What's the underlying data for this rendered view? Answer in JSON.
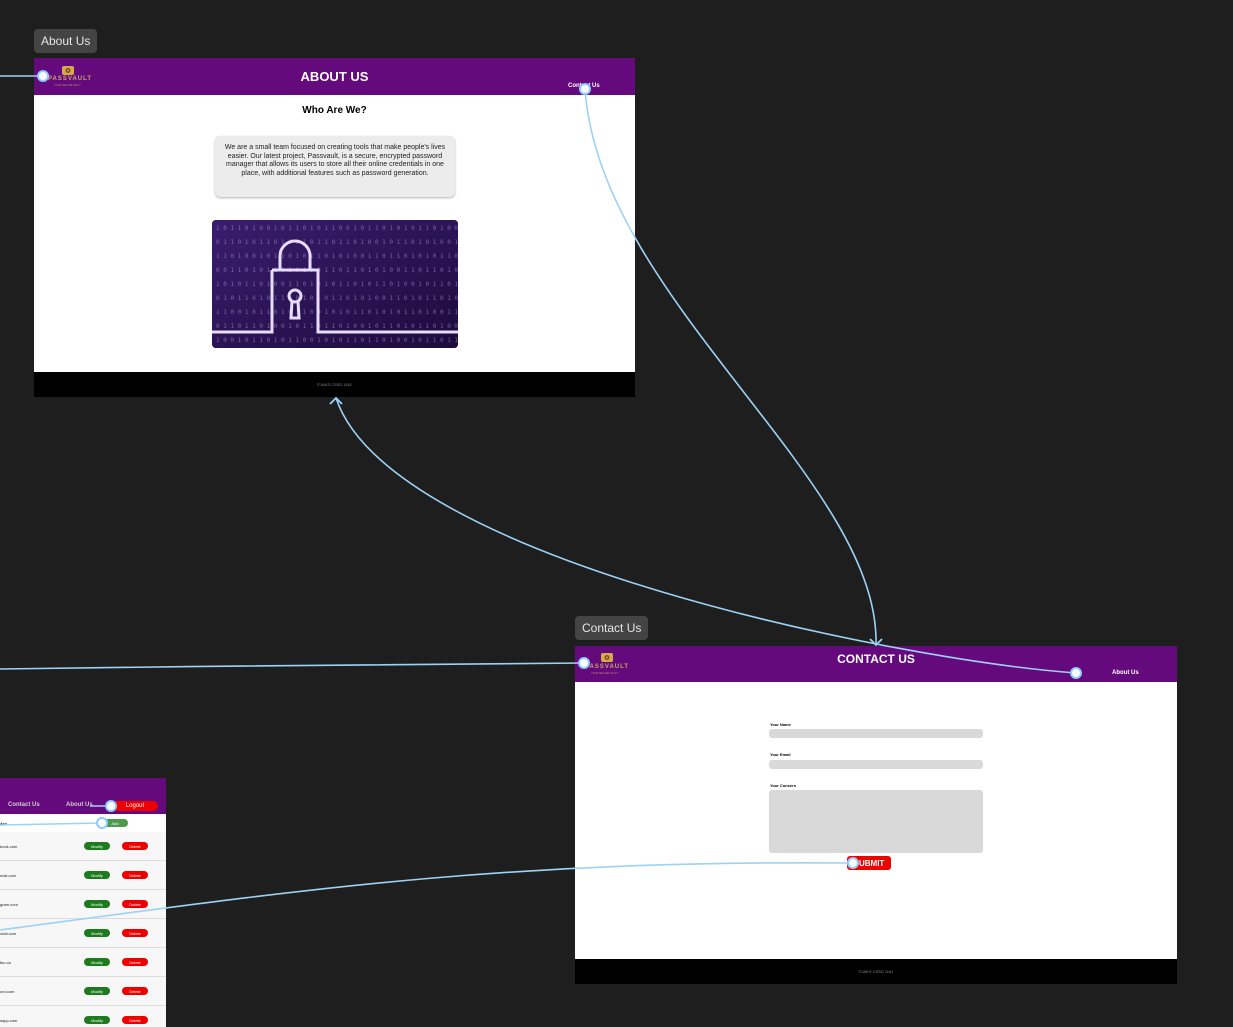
{
  "canvas": {
    "connector_color": "#9dd2f5",
    "frames": [
      {
        "id": "about",
        "label": "About Us"
      },
      {
        "id": "contact",
        "label": "Contact Us"
      }
    ]
  },
  "brand": {
    "primary": "#650a7c",
    "footer": "#000000",
    "danger": "#ee0000",
    "success": "#1d7a1d"
  },
  "about": {
    "logo_word": "PASSVAULT",
    "logo_sub": "YOUR SECURE VAULT",
    "title": "ABOUT US",
    "nav_contact": "Contact Us",
    "heading": "Who Are We?",
    "body": "We are a small team focused on creating tools that make people's lives easier. Our latest project, Passvault, is a secure, encrypted password manager that allows its users to store all their online credentials in one place, with additional features such as password generation.",
    "hero_icon": "padlock-icon",
    "footer": "©JAKS CSSD 1161"
  },
  "contact": {
    "logo_word": "PASSVAULT",
    "logo_sub": "YOUR SECURE VAULT",
    "title": "CONTACT US",
    "nav_about": "About Us",
    "name_label": "Your Name",
    "email_label": "Your Email",
    "concern_label": "Your Concern",
    "submit": "SUBMIT",
    "footer": "©JAKS CSSD 1161"
  },
  "dashboard": {
    "nav_contact": "Contact Us",
    "nav_about": "About Us",
    "logout": "Logout",
    "heading": "Acc",
    "add": "Add",
    "modify": "Modify",
    "delete": "Delete",
    "rows": [
      {
        "site": "book.com"
      },
      {
        "site": "mail.com"
      },
      {
        "site": "gram.com"
      },
      {
        "site": "chat.com"
      },
      {
        "site": "tko.ca"
      },
      {
        "site": "ord.com"
      },
      {
        "site": "sapp.com"
      }
    ]
  }
}
